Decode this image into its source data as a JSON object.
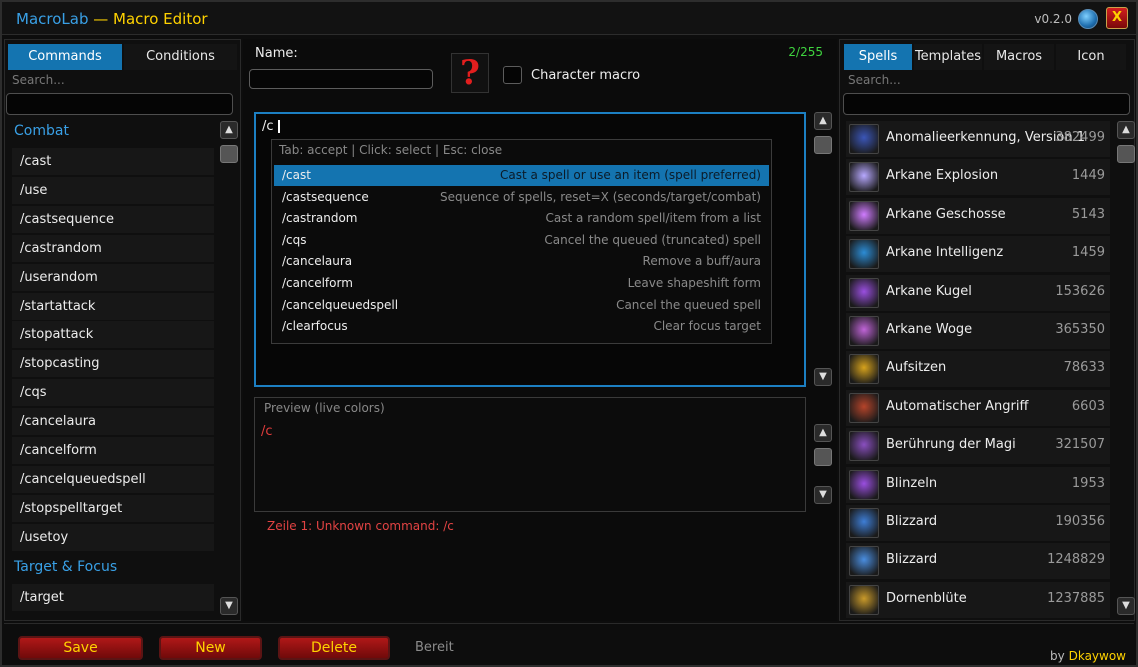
{
  "window": {
    "app_name": "MacroLab",
    "separator": " — ",
    "title": "Macro Editor",
    "version": "v0.2.0",
    "close_label": "X"
  },
  "left": {
    "tabs": [
      {
        "label": "Commands",
        "active": true
      },
      {
        "label": "Conditions",
        "active": false
      }
    ],
    "search_placeholder": "Search...",
    "categories": [
      {
        "label": "Combat",
        "items": [
          "/cast",
          "/use",
          "/castsequence",
          "/castrandom",
          "/userandom",
          "/startattack",
          "/stopattack",
          "/stopcasting",
          "/cqs",
          "/cancelaura",
          "/cancelform",
          "/cancelqueuedspell",
          "/stopspelltarget",
          "/usetoy"
        ]
      },
      {
        "label": "Target & Focus",
        "items": [
          "/target"
        ]
      }
    ]
  },
  "editor": {
    "name_label": "Name:",
    "name_value": "",
    "char_count": "2/255",
    "icon_glyph": "?",
    "icon_name": "question-mark-icon",
    "character_macro_label": "Character macro",
    "character_macro_checked": false,
    "text": "/c",
    "autocomplete": {
      "hint": "Tab: accept | Click: select | Esc: close",
      "items": [
        {
          "cmd": "/cast",
          "desc": "Cast a spell or use an item (spell preferred)",
          "selected": true
        },
        {
          "cmd": "/castsequence",
          "desc": "Sequence of spells, reset=X (seconds/target/combat)"
        },
        {
          "cmd": "/castrandom",
          "desc": "Cast a random spell/item from a list"
        },
        {
          "cmd": "/cqs",
          "desc": "Cancel the queued (truncated) spell"
        },
        {
          "cmd": "/cancelaura",
          "desc": "Remove a buff/aura"
        },
        {
          "cmd": "/cancelform",
          "desc": "Leave shapeshift form"
        },
        {
          "cmd": "/cancelqueuedspell",
          "desc": "Cancel the queued spell"
        },
        {
          "cmd": "/clearfocus",
          "desc": "Clear focus target"
        }
      ]
    },
    "preview_label": "Preview (live colors)",
    "preview_text": "/c",
    "error": "Zeile 1: Unknown command: /c"
  },
  "right": {
    "tabs": [
      {
        "label": "Spells",
        "active": true
      },
      {
        "label": "Templates"
      },
      {
        "label": "Macros"
      },
      {
        "label": "Icon"
      }
    ],
    "search_placeholder": "Search...",
    "spells": [
      {
        "name": "Anomalieerkennung, Version 1",
        "id": "382499",
        "color": "#3b56b8"
      },
      {
        "name": "Arkane Explosion",
        "id": "1449",
        "color": "#b7a8ff"
      },
      {
        "name": "Arkane Geschosse",
        "id": "5143",
        "color": "#d07cff"
      },
      {
        "name": "Arkane Intelligenz",
        "id": "1459",
        "color": "#2c8dd6"
      },
      {
        "name": "Arkane Kugel",
        "id": "153626",
        "color": "#9a4fe0"
      },
      {
        "name": "Arkane Woge",
        "id": "365350",
        "color": "#c064d8"
      },
      {
        "name": "Aufsitzen",
        "id": "78633",
        "color": "#d6a21c"
      },
      {
        "name": "Automatischer Angriff",
        "id": "6603",
        "color": "#b5442a"
      },
      {
        "name": "Berührung der Magi",
        "id": "321507",
        "color": "#8a4fc0"
      },
      {
        "name": "Blinzeln",
        "id": "1953",
        "color": "#9a4ee0"
      },
      {
        "name": "Blizzard",
        "id": "190356",
        "color": "#3e7ed6"
      },
      {
        "name": "Blizzard",
        "id": "1248829",
        "color": "#4a8ee0"
      },
      {
        "name": "Dornenblüte",
        "id": "1237885",
        "color": "#c99a2a"
      }
    ]
  },
  "footer": {
    "save": "Save",
    "new": "New",
    "delete": "Delete",
    "status": "Bereit",
    "by": "by ",
    "author": "Dkaywow"
  },
  "colors": {
    "accent": "#1474b0",
    "title": "#ffd200",
    "app": "#39a0e6",
    "error": "#e24343",
    "count": "#3fd43f"
  }
}
